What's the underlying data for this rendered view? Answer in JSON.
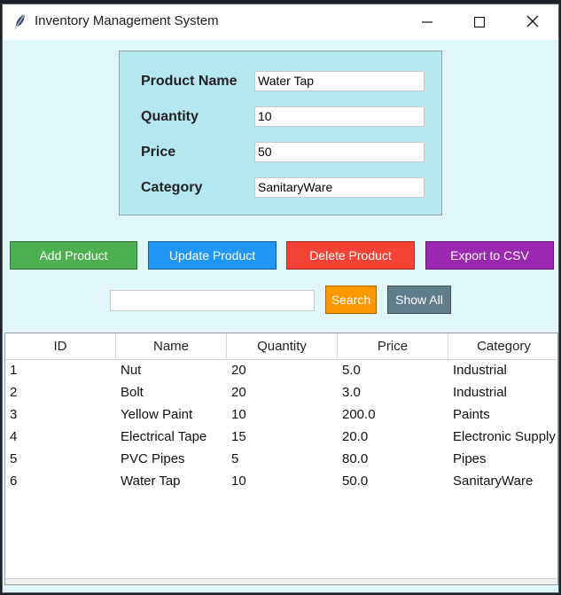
{
  "window": {
    "title": "Inventory Management System"
  },
  "form": {
    "fields": [
      {
        "label": "Product Name",
        "value": "Water Tap"
      },
      {
        "label": "Quantity",
        "value": "10"
      },
      {
        "label": "Price",
        "value": "50"
      },
      {
        "label": "Category",
        "value": "SanitaryWare"
      }
    ]
  },
  "actions": {
    "add": "Add Product",
    "update": "Update Product",
    "delete": "Delete Product",
    "export": "Export to CSV"
  },
  "search": {
    "value": "",
    "search_label": "Search",
    "show_all_label": "Show All"
  },
  "colors": {
    "add": "#4caf50",
    "update": "#2196f3",
    "delete": "#f44336",
    "export": "#9c27b0",
    "search": "#ff9800",
    "show_all": "#607d8b"
  },
  "table": {
    "columns": [
      "ID",
      "Name",
      "Quantity",
      "Price",
      "Category"
    ],
    "rows": [
      [
        "1",
        "Nut",
        "20",
        "5.0",
        "Industrial"
      ],
      [
        "2",
        "Bolt",
        "20",
        "3.0",
        "Industrial"
      ],
      [
        "3",
        "Yellow Paint",
        "10",
        "200.0",
        "Paints"
      ],
      [
        "4",
        "Electrical Tape",
        "15",
        "20.0",
        "Electronic Supply"
      ],
      [
        "5",
        "PVC Pipes",
        "5",
        "80.0",
        "Pipes"
      ],
      [
        "6",
        "Water Tap",
        "10",
        "50.0",
        "SanitaryWare"
      ]
    ]
  }
}
